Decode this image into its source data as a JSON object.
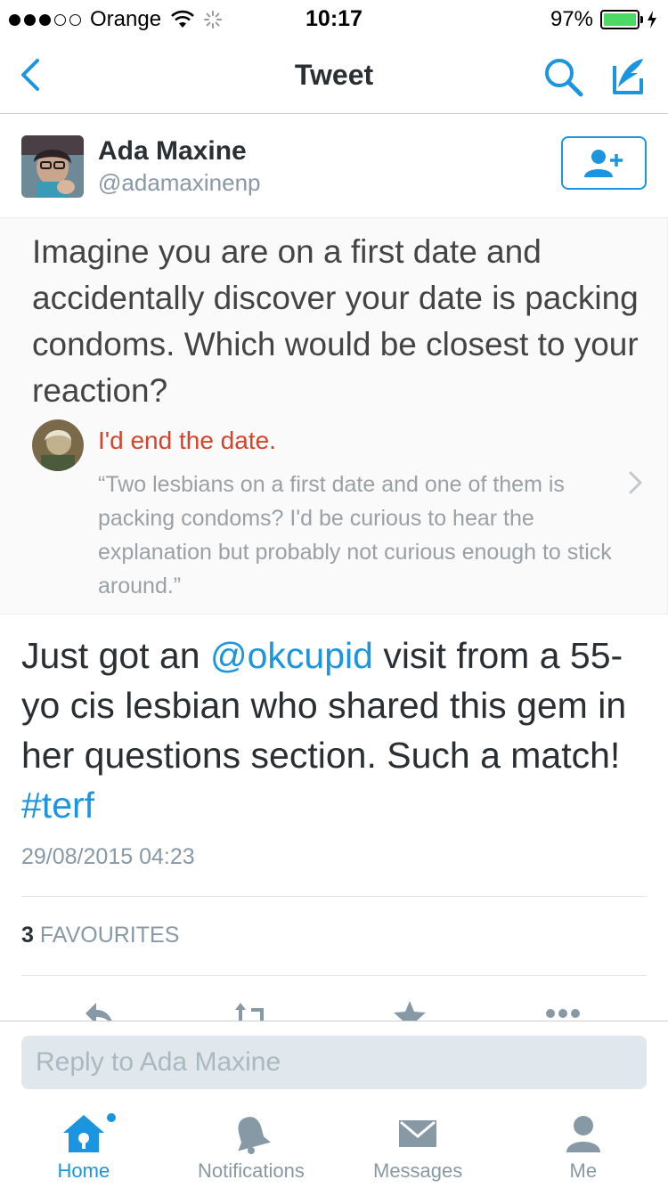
{
  "status_bar": {
    "carrier": "Orange",
    "time": "10:17",
    "battery": "97%",
    "signal_bars": 3,
    "signal_total": 5
  },
  "nav": {
    "title": "Tweet",
    "back_icon": "chevron-left-icon",
    "search_icon": "search-icon",
    "compose_icon": "compose-icon"
  },
  "tweet": {
    "author_name": "Ada Maxine",
    "author_handle": "@adamaxinenp",
    "text_before": "Just got an ",
    "mention": "@okcupid",
    "text_after": " visit from a 55-yo cis lesbian who shared this gem in her questions section. Such a match! ",
    "hashtag": "#terf",
    "date": "29/08/2015 04:23",
    "favourites_count": "3",
    "favourites_label": "FAVOURITES"
  },
  "image_card": {
    "question": "Imagine you are on a first date and accidentally discover your date is packing condoms. Which would be closest to your reaction?",
    "answer": "I'd end the date.",
    "quote": "“Two lesbians on a first date and one of them is packing condoms? I'd be curious to hear the explanation but probably not curious enough to stick around.”"
  },
  "actions": {
    "reply_icon": "reply-icon",
    "retweet_icon": "retweet-icon",
    "favourite_icon": "star-icon",
    "more_icon": "more-icon"
  },
  "reply": {
    "placeholder": "Reply to Ada Maxine"
  },
  "tabs": [
    {
      "label": "Home",
      "icon": "home-icon",
      "active": true
    },
    {
      "label": "Notifications",
      "icon": "bell-icon",
      "active": false
    },
    {
      "label": "Messages",
      "icon": "envelope-icon",
      "active": false
    },
    {
      "label": "Me",
      "icon": "person-icon",
      "active": false
    }
  ],
  "colors": {
    "accent": "#1b95e0",
    "text": "#292f33",
    "muted": "#8899a6",
    "answer_red": "#d4442c"
  }
}
